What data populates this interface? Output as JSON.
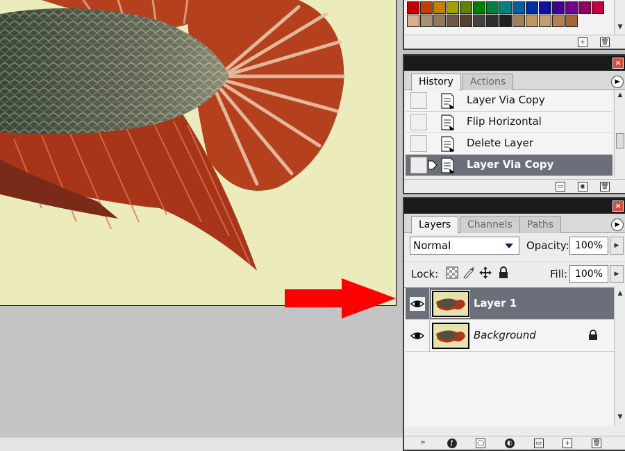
{
  "swatches": {
    "rows": [
      [
        "#c00000",
        "#c04000",
        "#c08000",
        "#a0a000",
        "#608000",
        "#008000",
        "#008040",
        "#008080",
        "#0060a0",
        "#0030a0",
        "#1010a0",
        "#400090",
        "#700090",
        "#900060",
        "#c00040"
      ],
      [
        "#d8b090",
        "#a89070",
        "#907860",
        "#705848",
        "#584030",
        "#484040",
        "#303030",
        "#202020",
        "#a08058",
        "#c09860",
        "#c0a070",
        "#b08050",
        "#a06838"
      ]
    ],
    "footer_icons": [
      "new-swatch-icon",
      "trash-icon"
    ]
  },
  "history": {
    "tabs": [
      {
        "label": "History",
        "active": true
      },
      {
        "label": "Actions",
        "active": false
      }
    ],
    "items": [
      {
        "label": "Layer Via Copy",
        "selected": false
      },
      {
        "label": "Flip Horizontal",
        "selected": false
      },
      {
        "label": "Delete Layer",
        "selected": false
      },
      {
        "label": "Layer Via Copy",
        "selected": true
      }
    ],
    "footer_icons": [
      "new-document-from-state-icon",
      "snapshot-icon",
      "trash-icon"
    ]
  },
  "layers": {
    "tabs": [
      {
        "label": "Layers",
        "active": true
      },
      {
        "label": "Channels",
        "active": false
      },
      {
        "label": "Paths",
        "active": false
      }
    ],
    "blend_mode": "Normal",
    "opacity_label": "Opacity:",
    "opacity_value": "100%",
    "lock_label": "Lock:",
    "fill_label": "Fill:",
    "fill_value": "100%",
    "items": [
      {
        "name": "Layer 1",
        "selected": true,
        "visible": true,
        "locked": false
      },
      {
        "name": "Background",
        "selected": false,
        "visible": true,
        "locked": true
      }
    ],
    "footer_icons": [
      "link-icon",
      "layer-style-icon",
      "layer-mask-icon",
      "adjustment-layer-icon",
      "group-folder-icon",
      "new-layer-icon",
      "trash-icon"
    ]
  },
  "colors": {
    "selection_bg": "#6b6f7a",
    "arrow": "#ff0000",
    "canvas_bg": "#ecebbc"
  }
}
